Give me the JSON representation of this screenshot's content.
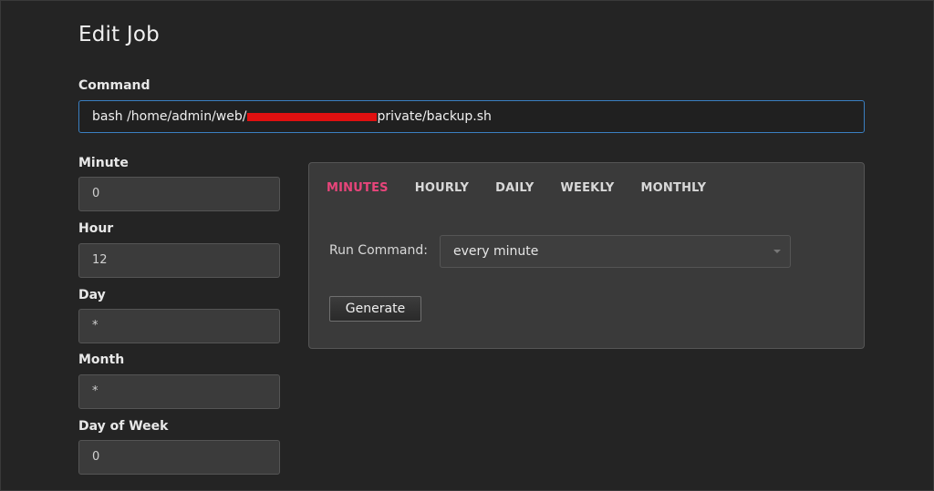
{
  "page": {
    "title": "Edit Job"
  },
  "command": {
    "label": "Command",
    "value_prefix": "bash /home/admin/web/",
    "value_suffix": "private/backup.sh"
  },
  "fields": {
    "minute": {
      "label": "Minute",
      "value": "0"
    },
    "hour": {
      "label": "Hour",
      "value": "12"
    },
    "day": {
      "label": "Day",
      "value": "*"
    },
    "month": {
      "label": "Month",
      "value": "*"
    },
    "day_of_week": {
      "label": "Day of Week",
      "value": "0"
    }
  },
  "generator": {
    "tabs": [
      "MINUTES",
      "HOURLY",
      "DAILY",
      "WEEKLY",
      "MONTHLY"
    ],
    "active_tab": "MINUTES",
    "run_label": "Run Command:",
    "run_value": "every minute",
    "generate_label": "Generate"
  },
  "colors": {
    "accent_tab": "#e8457b",
    "focus_border": "#3a7fc1",
    "redaction": "#e01010"
  }
}
